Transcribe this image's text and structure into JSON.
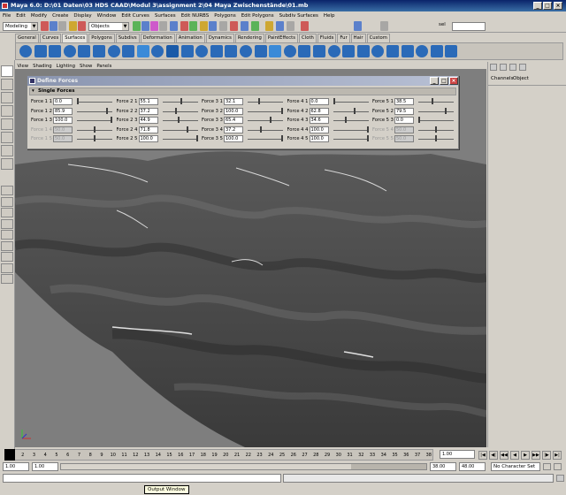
{
  "window": {
    "title": "Maya 6.0: D:\\01 Daten\\03 HDS CAAD\\Modul 3\\assignment 2\\04 Maya Zwischenstände\\01.mb"
  },
  "menubar": [
    "File",
    "Edit",
    "Modify",
    "Create",
    "Display",
    "Window",
    "Edit Curves",
    "Surfaces",
    "Edit NURBS",
    "Polygons",
    "Edit Polygons",
    "Subdiv Surfaces",
    "Help"
  ],
  "statusline": {
    "mode": "Modeling",
    "objects": "Objects",
    "sel": "sel"
  },
  "shelf_tabs": [
    "General",
    "Curves",
    "Surfaces",
    "Polygons",
    "Subdivs",
    "Deformation",
    "Animation",
    "Dynamics",
    "Rendering",
    "PaintEffects",
    "Cloth",
    "Fluids",
    "Fur",
    "Hair",
    "Custom"
  ],
  "active_shelf": "Surfaces",
  "viewport_menu": [
    "View",
    "Shading",
    "Lighting",
    "Show",
    "Panels"
  ],
  "channel_box": {
    "tabs": [
      "Channels",
      "Object"
    ]
  },
  "dialog": {
    "title": "Define Forces",
    "section": "Single Forces",
    "columns": [
      {
        "rows": [
          {
            "label": "Force 1 1",
            "value": "0.0",
            "level": 0.0,
            "enabled": true
          },
          {
            "label": "Force 1 2",
            "value": "85.9",
            "level": 0.859,
            "enabled": true
          },
          {
            "label": "Force 1 3",
            "value": "100.0",
            "level": 1.0,
            "enabled": true
          },
          {
            "label": "Force 1 4",
            "value": "50.0",
            "level": 0.5,
            "enabled": false
          },
          {
            "label": "Force 1 5",
            "value": "50.0",
            "level": 0.5,
            "enabled": false
          }
        ]
      },
      {
        "rows": [
          {
            "label": "Force 2 1",
            "value": "55.1",
            "level": 0.551,
            "enabled": true
          },
          {
            "label": "Force 2 2",
            "value": "37.2",
            "level": 0.372,
            "enabled": true
          },
          {
            "label": "Force 2 3",
            "value": "44.9",
            "level": 0.449,
            "enabled": true
          },
          {
            "label": "Force 2 4",
            "value": "71.8",
            "level": 0.718,
            "enabled": true
          },
          {
            "label": "Force 2 5",
            "value": "100.0",
            "level": 1.0,
            "enabled": true
          }
        ]
      },
      {
        "rows": [
          {
            "label": "Force 3 1",
            "value": "32.1",
            "level": 0.321,
            "enabled": true
          },
          {
            "label": "Force 3 2",
            "value": "100.0",
            "level": 1.0,
            "enabled": true
          },
          {
            "label": "Force 3 3",
            "value": "65.4",
            "level": 0.654,
            "enabled": true
          },
          {
            "label": "Force 3 4",
            "value": "37.2",
            "level": 0.372,
            "enabled": true
          },
          {
            "label": "Force 3 5",
            "value": "100.0",
            "level": 1.0,
            "enabled": true
          }
        ]
      },
      {
        "rows": [
          {
            "label": "Force 4 1",
            "value": "0.0",
            "level": 0.0,
            "enabled": true
          },
          {
            "label": "Force 4 2",
            "value": "62.8",
            "level": 0.628,
            "enabled": true
          },
          {
            "label": "Force 4 3",
            "value": "34.6",
            "level": 0.346,
            "enabled": true
          },
          {
            "label": "Force 4 4",
            "value": "100.0",
            "level": 1.0,
            "enabled": true
          },
          {
            "label": "Force 4 5",
            "value": "100.0",
            "level": 1.0,
            "enabled": true
          }
        ]
      },
      {
        "rows": [
          {
            "label": "Force 5 1",
            "value": "38.5",
            "level": 0.385,
            "enabled": true
          },
          {
            "label": "Force 5 2",
            "value": "79.5",
            "level": 0.795,
            "enabled": true
          },
          {
            "label": "Force 5 3",
            "value": "0.0",
            "level": 0.0,
            "enabled": true
          },
          {
            "label": "Force 5 4",
            "value": "50.0",
            "level": 0.5,
            "enabled": false
          },
          {
            "label": "Force 5 5",
            "value": "50.0",
            "level": 0.5,
            "enabled": false
          }
        ]
      }
    ]
  },
  "timeline": {
    "ticks": [
      "1",
      "2",
      "3",
      "4",
      "5",
      "6",
      "7",
      "8",
      "9",
      "10",
      "11",
      "12",
      "13",
      "14",
      "15",
      "16",
      "17",
      "18",
      "19",
      "20",
      "21",
      "22",
      "23",
      "24",
      "25",
      "26",
      "27",
      "28",
      "29",
      "30",
      "31",
      "32",
      "33",
      "34",
      "35",
      "36",
      "37",
      "38"
    ],
    "current_frame": "1.00"
  },
  "range": {
    "start": "1.00",
    "inner_start": "1.00",
    "inner_end": "38.00",
    "end": "48.00",
    "character_set": "No Character Set"
  },
  "helpline": {
    "tooltip": "Output Window"
  }
}
